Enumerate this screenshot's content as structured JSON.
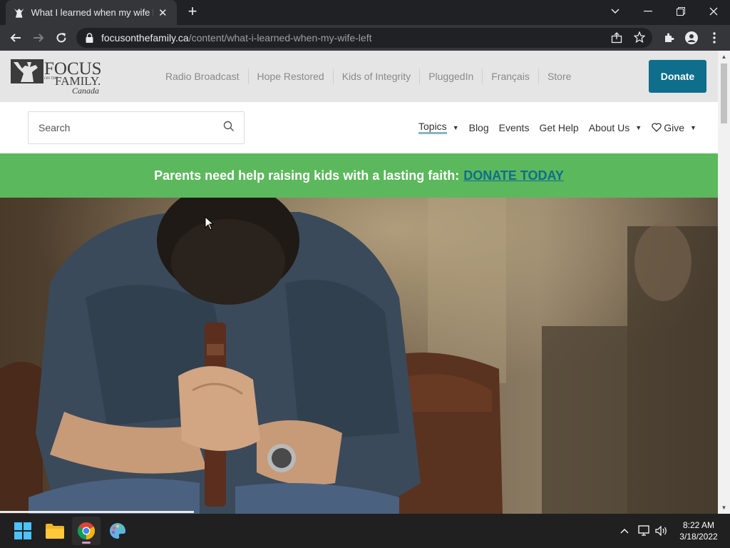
{
  "browser": {
    "tab": {
      "title": "What I learned when my wife left"
    },
    "omnibox": {
      "host": "focusonthefamily.ca",
      "path": "/content/what-i-learned-when-my-wife-left"
    }
  },
  "site": {
    "logo": {
      "line1": "FOCUS",
      "small": "ON THE",
      "line2": "FAMILY.",
      "line3": "Canada"
    },
    "top_links": [
      "Radio Broadcast",
      "Hope Restored",
      "Kids of Integrity",
      "PluggedIn",
      "Français",
      "Store"
    ],
    "donate_label": "Donate",
    "search": {
      "placeholder": "Search"
    },
    "nav": [
      {
        "label": "Topics",
        "caret": true,
        "active": true
      },
      {
        "label": "Blog"
      },
      {
        "label": "Events"
      },
      {
        "label": "Get Help"
      },
      {
        "label": "About Us",
        "caret": true
      },
      {
        "label": "Give",
        "caret": true
      }
    ],
    "promo": {
      "text": "Parents need help raising kids with a lasting faith:",
      "link": "DONATE TODAY"
    },
    "colors": {
      "promo_bg": "#5cb85c",
      "donate_bg": "#0e6e8c",
      "topbar_bg": "#e5e5e5"
    }
  },
  "taskbar": {
    "apps": [
      "windows-start",
      "file-explorer",
      "chrome",
      "paint"
    ],
    "time": "8:22 AM",
    "date": "3/18/2022"
  }
}
